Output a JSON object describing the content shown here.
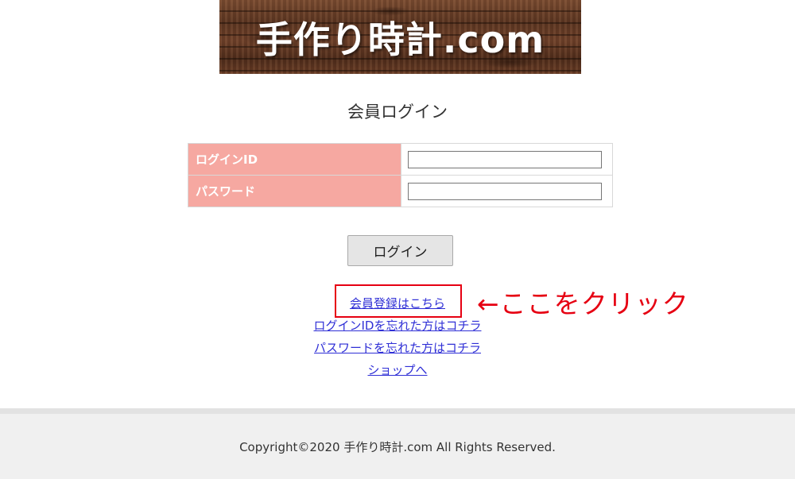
{
  "logo": {
    "text": "手作り時計.com"
  },
  "page_title": "会員ログイン",
  "form": {
    "fields": [
      {
        "label": "ログインID",
        "value": "",
        "placeholder": ""
      },
      {
        "label": "パスワード",
        "value": "",
        "placeholder": ""
      }
    ],
    "submit_label": "ログイン"
  },
  "links": [
    {
      "label": "会員登録はこちら"
    },
    {
      "label": "ログインIDを忘れた方はコチラ"
    },
    {
      "label": "パスワードを忘れた方はコチラ"
    },
    {
      "label": "ショップへ"
    }
  ],
  "annotation": {
    "text": "←ここをクリック",
    "color": "#e60012"
  },
  "footer": {
    "copyright": "Copyright©2020 手作り時計.com All Rights Reserved."
  },
  "colors": {
    "label_bg": "#f6a8a1",
    "link": "#2f2fd6",
    "footer_bg": "#f0f0f0"
  }
}
